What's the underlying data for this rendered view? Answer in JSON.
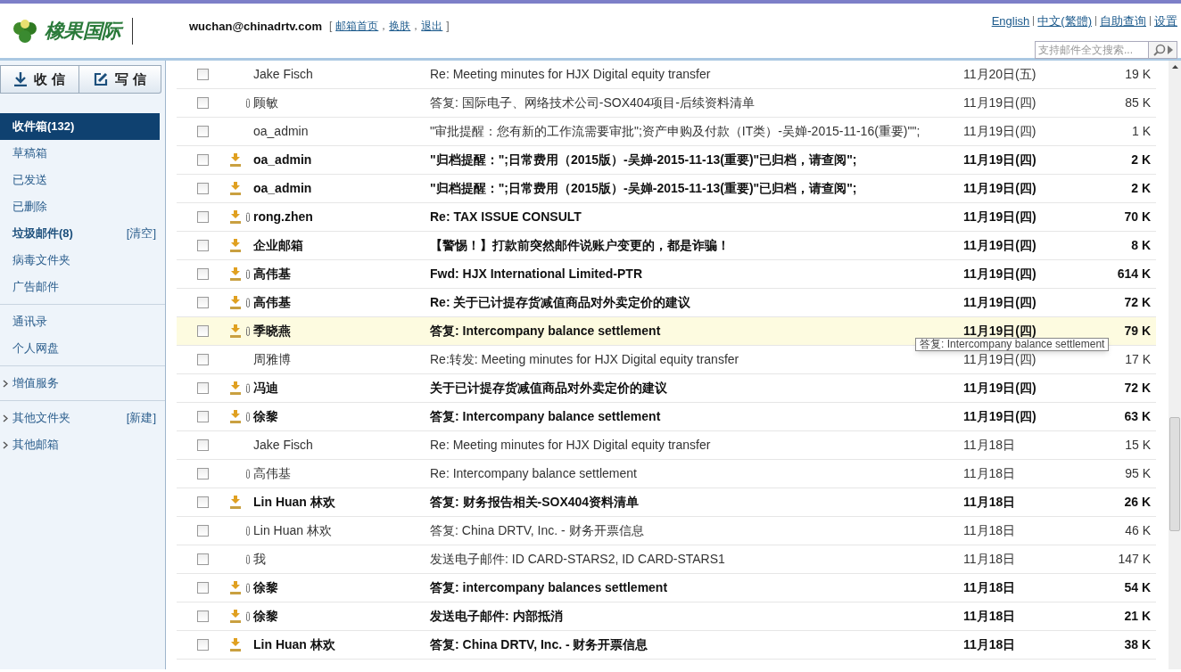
{
  "header": {
    "logo_text": "橡果国际",
    "account": "wuchan@chinadrtv.com",
    "account_links": [
      "邮箱首页",
      "换肤",
      "退出"
    ],
    "account_links_open": "[",
    "account_links_separator": "，",
    "account_links_close": "]",
    "top_links": [
      "English",
      "中文(繁體)",
      "自助查询",
      "设置"
    ],
    "search": {
      "placeholder": "支持邮件全文搜索..."
    }
  },
  "sidebar": {
    "buttons": [
      "收 信",
      "写 信"
    ],
    "groups": [
      [
        {
          "label": "收件箱(132)",
          "selected": true,
          "bold": true
        },
        {
          "label": "草稿箱",
          "selected": false,
          "bold": false
        },
        {
          "label": "已发送",
          "selected": false,
          "bold": false
        },
        {
          "label": "已删除",
          "selected": false,
          "bold": false
        },
        {
          "label": "垃圾邮件(8)",
          "selected": false,
          "bold": true,
          "action": "[清空]"
        },
        {
          "label": "病毒文件夹",
          "selected": false,
          "bold": false
        },
        {
          "label": "广告邮件",
          "selected": false,
          "bold": false
        }
      ],
      [
        {
          "label": "通讯录",
          "selected": false,
          "bold": false
        },
        {
          "label": "个人网盘",
          "selected": false,
          "bold": false
        }
      ],
      [
        {
          "label": "增值服务",
          "selected": false,
          "bold": false,
          "expander": true
        }
      ],
      [
        {
          "label": "其他文件夹",
          "selected": false,
          "bold": false,
          "expander": true,
          "action": "[新建]"
        },
        {
          "label": "其他邮箱",
          "selected": false,
          "bold": false,
          "expander": true
        }
      ]
    ]
  },
  "messages": [
    {
      "sender": "Jake Fisch",
      "subject": "Re: Meeting minutes for HJX Digital equity transfer",
      "date": "11月20日(五)",
      "size": "19 K",
      "unread": false,
      "pop": false,
      "attachment": false,
      "hovered": false
    },
    {
      "sender": "顾敏",
      "subject": "答复: 国际电子、网络技术公司-SOX404项目-后续资料清单",
      "date": "11月19日(四)",
      "size": "85 K",
      "unread": false,
      "pop": false,
      "attachment": true,
      "hovered": false
    },
    {
      "sender": "oa_admin",
      "subject": "\"审批提醒：您有新的工作流需要审批\";资产申购及付款（IT类）-吴婵-2015-11-16(重要)\"\";",
      "date": "11月19日(四)",
      "size": "1 K",
      "unread": false,
      "pop": false,
      "attachment": false,
      "hovered": false
    },
    {
      "sender": "oa_admin",
      "subject": "\"归档提醒：\";日常费用（2015版）-吴婵-2015-11-13(重要)\"已归档，请查阅\";",
      "date": "11月19日(四)",
      "size": "2 K",
      "unread": true,
      "pop": true,
      "attachment": false,
      "hovered": false
    },
    {
      "sender": "oa_admin",
      "subject": "\"归档提醒：\";日常费用（2015版）-吴婵-2015-11-13(重要)\"已归档，请查阅\";",
      "date": "11月19日(四)",
      "size": "2 K",
      "unread": true,
      "pop": true,
      "attachment": false,
      "hovered": false
    },
    {
      "sender": "rong.zhen",
      "subject": "Re: TAX ISSUE CONSULT",
      "date": "11月19日(四)",
      "size": "70 K",
      "unread": true,
      "pop": true,
      "attachment": true,
      "hovered": false
    },
    {
      "sender": "企业邮箱",
      "subject": "【警惕！】打款前突然邮件说账户变更的，都是诈骗！",
      "date": "11月19日(四)",
      "size": "8 K",
      "unread": true,
      "pop": true,
      "attachment": false,
      "hovered": false
    },
    {
      "sender": "高伟基",
      "subject": "Fwd: HJX International Limited-PTR",
      "date": "11月19日(四)",
      "size": "614 K",
      "unread": true,
      "pop": true,
      "attachment": true,
      "hovered": false
    },
    {
      "sender": "高伟基",
      "subject": "Re: 关于已计提存货减值商品对外卖定价的建议",
      "date": "11月19日(四)",
      "size": "72 K",
      "unread": true,
      "pop": true,
      "attachment": true,
      "hovered": false
    },
    {
      "sender": "季晓燕",
      "subject": "答复: Intercompany balance settlement",
      "date": "11月19日(四)",
      "size": "79 K",
      "unread": true,
      "pop": true,
      "attachment": true,
      "hovered": true
    },
    {
      "sender": "周雅博",
      "subject": "Re:转发: Meeting minutes for HJX Digital equity transfer",
      "date": "11月19日(四)",
      "size": "17 K",
      "unread": false,
      "pop": false,
      "attachment": false,
      "hovered": false
    },
    {
      "sender": "冯迪",
      "subject": "关于已计提存货减值商品对外卖定价的建议",
      "date": "11月19日(四)",
      "size": "72 K",
      "unread": true,
      "pop": true,
      "attachment": true,
      "hovered": false
    },
    {
      "sender": "徐黎",
      "subject": "答复: Intercompany balance settlement",
      "date": "11月19日(四)",
      "size": "63 K",
      "unread": true,
      "pop": true,
      "attachment": true,
      "hovered": false
    },
    {
      "sender": "Jake Fisch",
      "subject": "Re: Meeting minutes for HJX Digital equity transfer",
      "date": "11月18日",
      "size": "15 K",
      "unread": false,
      "pop": false,
      "attachment": false,
      "hovered": false
    },
    {
      "sender": "高伟基",
      "subject": "Re: Intercompany balance settlement",
      "date": "11月18日",
      "size": "95 K",
      "unread": false,
      "pop": false,
      "attachment": true,
      "hovered": false
    },
    {
      "sender": "Lin Huan 林欢",
      "subject": "答复: 财务报告相关-SOX404资料清单",
      "date": "11月18日",
      "size": "26 K",
      "unread": true,
      "pop": true,
      "attachment": false,
      "hovered": false
    },
    {
      "sender": "Lin Huan 林欢",
      "subject": "答复: China DRTV, Inc. - 财务开票信息",
      "date": "11月18日",
      "size": "46 K",
      "unread": false,
      "pop": false,
      "attachment": true,
      "hovered": false
    },
    {
      "sender": "我",
      "subject": "发送电子邮件: ID CARD-STARS2, ID CARD-STARS1",
      "date": "11月18日",
      "size": "147 K",
      "unread": false,
      "pop": false,
      "attachment": true,
      "hovered": false
    },
    {
      "sender": "徐黎",
      "subject": "答复: intercompany balances settlement",
      "date": "11月18日",
      "size": "54 K",
      "unread": true,
      "pop": true,
      "attachment": true,
      "hovered": false
    },
    {
      "sender": "徐黎",
      "subject": "发送电子邮件: 内部抵消",
      "date": "11月18日",
      "size": "21 K",
      "unread": true,
      "pop": true,
      "attachment": true,
      "hovered": false
    },
    {
      "sender": "Lin Huan 林欢",
      "subject": "答复: China DRTV, Inc. - 财务开票信息",
      "date": "11月18日",
      "size": "38 K",
      "unread": true,
      "pop": true,
      "attachment": false,
      "hovered": false
    }
  ],
  "tooltip": "答复: Intercompany balance settlement"
}
